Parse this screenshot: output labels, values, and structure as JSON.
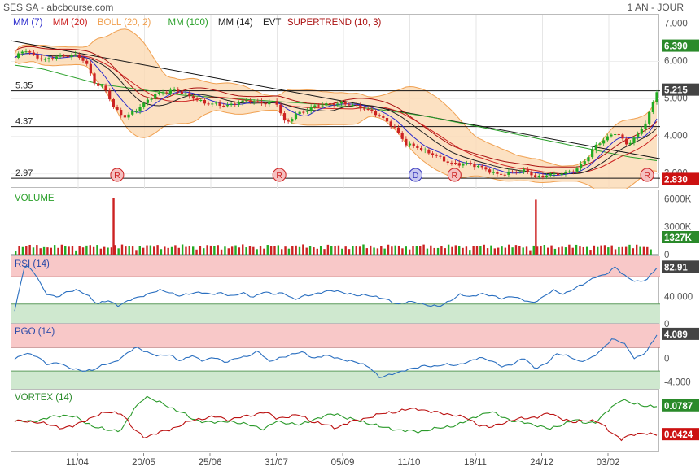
{
  "header": {
    "title": "SES SA - abcbourse.com",
    "period": "1 AN - JOUR"
  },
  "colors": {
    "mm7": "#2a2acc",
    "mm20": "#cc2222",
    "boll": "#f0a050",
    "boll_fill": "#fbd9b3",
    "mm100": "#2aa02a",
    "mm14": "#222222",
    "supertrend": "#aa1111",
    "rsi_line": "#2a6fc0",
    "up": "#22aa22",
    "down": "#cc2222",
    "overbought": "#f8c8c8",
    "oversold": "#cfe8cf",
    "badge_green": "#2a8a2a",
    "badge_red": "#cc1111",
    "badge_price": "#444444",
    "vortex_pos": "#2a9a2a",
    "vortex_neg": "#bb1111"
  },
  "legend": [
    {
      "label": "MM (7)",
      "color": "#2a2acc"
    },
    {
      "label": "MM (20)",
      "color": "#cc2222"
    },
    {
      "label": "BOLL (20, 2)",
      "color": "#f0a050"
    },
    {
      "label": "MM (100)",
      "color": "#2aa02a"
    },
    {
      "label": "MM (14)",
      "color": "#222222"
    },
    {
      "label": "EVT",
      "color": "#222222"
    },
    {
      "label": "SUPERTREND (10, 3)",
      "color": "#aa1111"
    }
  ],
  "chart_data": [
    {
      "type": "line",
      "panel": "price",
      "ylim": [
        2.6,
        7.25
      ],
      "yticks": [
        "7.000",
        "6.000",
        "5.000",
        "4.000",
        "3.000"
      ],
      "ytick_values": [
        7,
        6,
        5,
        4,
        3
      ],
      "x_labels": [
        "11/04",
        "20/05",
        "25/06",
        "31/07",
        "05/09",
        "11/10",
        "18/11",
        "24/12",
        "03/02"
      ],
      "horizontal_levels": [
        {
          "label": "5.35",
          "value": 5.215
        },
        {
          "label": "4.37",
          "value": 4.26
        },
        {
          "label": "2.97",
          "value": 2.88
        }
      ],
      "trendline": {
        "from": [
          0,
          6.55
        ],
        "to": [
          1,
          3.4
        ]
      },
      "price_badges": [
        {
          "label": "6.390",
          "value": 6.39,
          "kind": "green"
        },
        {
          "label": "5.215",
          "value": 5.215,
          "kind": "price"
        },
        {
          "label": "2.830",
          "value": 2.83,
          "kind": "red"
        }
      ],
      "events": [
        {
          "label": "R",
          "x": 0.163,
          "kind": "red"
        },
        {
          "label": "R",
          "x": 0.413,
          "kind": "red"
        },
        {
          "label": "D",
          "x": 0.623,
          "kind": "blue"
        },
        {
          "label": "R",
          "x": 0.683,
          "kind": "red"
        },
        {
          "label": "R",
          "x": 0.98,
          "kind": "red"
        }
      ],
      "close_series": [
        6.1,
        6.3,
        6.15,
        6.05,
        6.1,
        6.15,
        6.2,
        6.0,
        5.4,
        5.3,
        4.7,
        4.5,
        4.7,
        4.9,
        5.1,
        5.2,
        5.25,
        5.1,
        5.0,
        4.9,
        4.85,
        4.8,
        4.9,
        4.95,
        4.9,
        4.9,
        4.95,
        4.3,
        4.6,
        4.7,
        4.8,
        4.85,
        4.9,
        4.85,
        4.8,
        4.75,
        4.6,
        4.4,
        4.2,
        3.8,
        3.7,
        3.6,
        3.5,
        3.3,
        3.25,
        3.3,
        3.2,
        3.1,
        3.0,
        3.0,
        3.05,
        3.1,
        2.9,
        2.95,
        3.0,
        3.05,
        3.1,
        3.4,
        3.8,
        3.95,
        4.1,
        3.8,
        4.0,
        4.4,
        5.215
      ],
      "mm100_series": [
        5.9,
        5.8,
        5.6,
        5.4,
        5.3,
        5.2,
        5.1,
        5.05,
        5.0,
        4.95,
        4.9,
        4.85,
        4.8,
        4.72,
        4.62,
        4.5,
        4.35,
        4.2,
        4.05,
        3.9,
        3.75,
        3.6,
        3.45,
        3.35
      ]
    },
    {
      "type": "bar",
      "panel": "volume",
      "title": "VOLUME",
      "ylim": [
        0,
        7000
      ],
      "yticks": [
        "6000K",
        "3000K",
        "0"
      ],
      "ytick_values": [
        6000,
        3000,
        0
      ],
      "badge": "1327K",
      "spikes": [
        {
          "x": 0.156,
          "value": 6200
        },
        {
          "x": 0.807,
          "value": 6000
        }
      ],
      "typical": 700
    },
    {
      "type": "line",
      "panel": "rsi",
      "title": "RSI (14)",
      "ylim": [
        0,
        100
      ],
      "yticks": [
        "40.000",
        "0"
      ],
      "ytick_values": [
        40,
        0
      ],
      "overbought": 70,
      "oversold": 30,
      "badge": "82.91",
      "values": [
        20,
        88,
        75,
        45,
        40,
        48,
        50,
        44,
        30,
        35,
        28,
        35,
        40,
        46,
        50,
        47,
        42,
        45,
        48,
        44,
        46,
        42,
        46,
        40,
        48,
        44,
        47,
        36,
        42,
        45,
        48,
        50,
        46,
        42,
        44,
        40,
        36,
        30,
        33,
        32,
        28,
        26,
        35,
        44,
        40,
        46,
        42,
        38,
        42,
        36,
        32,
        40,
        50,
        45,
        52,
        60,
        70,
        72,
        85,
        70,
        62,
        66,
        82.91
      ]
    },
    {
      "type": "line",
      "panel": "pgo",
      "title": "PGO (14)",
      "ylim": [
        -5,
        6
      ],
      "yticks": [
        "4.000",
        "0",
        "-4.000"
      ],
      "ytick_values": [
        4,
        0,
        -4
      ],
      "upper": 2,
      "lower": -2,
      "badge": "4.089",
      "values": [
        0,
        1,
        0.6,
        -1,
        -0.5,
        -1.5,
        -2,
        -1.8,
        -1,
        -0.5,
        0.8,
        2,
        1.2,
        0.5,
        0.8,
        -0.3,
        0.6,
        -0.2,
        0.3,
        -0.5,
        0.2,
        0.4,
        1.5,
        -0.5,
        0.3,
        0.8,
        1.2,
        0.2,
        0.6,
        0.3,
        -0.2,
        -0.6,
        -1.2,
        -3.2,
        -2.5,
        -2,
        -1.6,
        -1,
        -1.3,
        -0.8,
        -1,
        -0.5,
        0.4,
        -0.3,
        -1.2,
        -0.8,
        0.2,
        -1.5,
        -0.8,
        1,
        0.6,
        -0.5,
        0.2,
        1.5,
        3.5,
        2.8,
        0,
        1.2,
        4.089
      ]
    },
    {
      "type": "line",
      "panel": "vortex",
      "title": "VORTEX (14)",
      "ylim": [
        0.02,
        0.1
      ],
      "badges": [
        {
          "label": "0.0787",
          "kind": "green"
        },
        {
          "label": "0.0424",
          "kind": "red"
        }
      ],
      "pos_series": [
        0.06,
        0.06,
        0.061,
        0.065,
        0.068,
        0.066,
        0.058,
        0.052,
        0.048,
        0.05,
        0.074,
        0.092,
        0.085,
        0.078,
        0.072,
        0.062,
        0.06,
        0.058,
        0.061,
        0.057,
        0.055,
        0.05,
        0.06,
        0.058,
        0.055,
        0.062,
        0.066,
        0.07,
        0.064,
        0.06,
        0.057,
        0.052,
        0.05,
        0.048,
        0.047,
        0.05,
        0.052,
        0.055,
        0.06,
        0.068,
        0.072,
        0.066,
        0.06,
        0.058,
        0.055,
        0.05,
        0.056,
        0.062,
        0.058,
        0.06,
        0.075,
        0.088,
        0.082,
        0.08,
        0.0787
      ],
      "neg_series": [
        0.06,
        0.06,
        0.059,
        0.055,
        0.052,
        0.054,
        0.062,
        0.068,
        0.072,
        0.07,
        0.05,
        0.04,
        0.045,
        0.05,
        0.055,
        0.062,
        0.064,
        0.066,
        0.062,
        0.065,
        0.068,
        0.072,
        0.064,
        0.066,
        0.068,
        0.06,
        0.056,
        0.052,
        0.058,
        0.062,
        0.066,
        0.07,
        0.072,
        0.075,
        0.076,
        0.072,
        0.07,
        0.068,
        0.064,
        0.056,
        0.052,
        0.058,
        0.062,
        0.064,
        0.066,
        0.07,
        0.064,
        0.058,
        0.062,
        0.06,
        0.048,
        0.038,
        0.043,
        0.046,
        0.0424
      ]
    }
  ]
}
